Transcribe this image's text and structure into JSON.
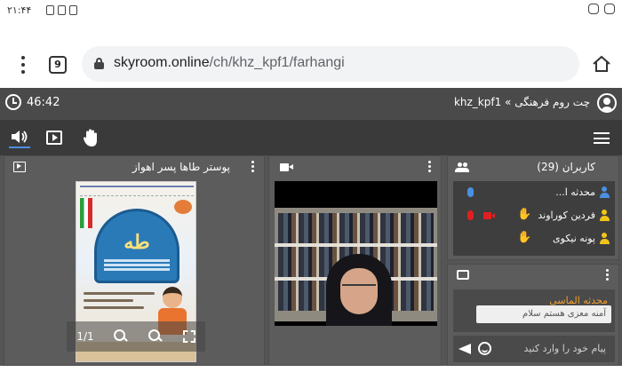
{
  "status_bar": {
    "time": "۲۱:۴۴"
  },
  "browser": {
    "tab_count": "9",
    "url_host": "skyroom.online",
    "url_path": "/ch/khz_kpf1/farhangi"
  },
  "app": {
    "timer": "46:42",
    "room_label": "چت روم فرهنگی » khz_kpf1"
  },
  "poster_panel": {
    "title": "پوستر طاها پسر اهواز",
    "poster_word": "طه",
    "page_indicator": "1/1"
  },
  "users_panel": {
    "title": "کاربران (29)",
    "users": [
      {
        "name": "محدثه ا...",
        "icon_color": "#4a90e2",
        "mic": "blue",
        "cam": "none",
        "hand": false
      },
      {
        "name": "فردین کوراوند",
        "icon_color": "#f0c419",
        "mic": "red",
        "cam": "red",
        "hand": true
      },
      {
        "name": "پونه نیکوی",
        "icon_color": "#f0c419",
        "mic": "none",
        "cam": "none",
        "hand": true
      }
    ]
  },
  "chat_panel": {
    "sender": "محدثه الماسی",
    "message": "آمنه معزی هستم سلام",
    "input_placeholder": "پیام خود را وارد کنید"
  },
  "colors": {
    "app_bar": "#4a4a4a",
    "toolbar": "#3a3a3a",
    "accent_blue": "#4a90e2",
    "sender_orange": "#f0a030"
  },
  "icons": [
    "clock-icon",
    "user-avatar-icon",
    "speaker-icon",
    "play-screen-icon",
    "raise-hand-icon",
    "hamburger-icon",
    "lock-icon",
    "home-icon",
    "camera-icon",
    "group-icon",
    "chat-icon",
    "send-icon",
    "smiley-icon",
    "zoom-in-icon",
    "zoom-out-icon",
    "fullscreen-icon"
  ]
}
